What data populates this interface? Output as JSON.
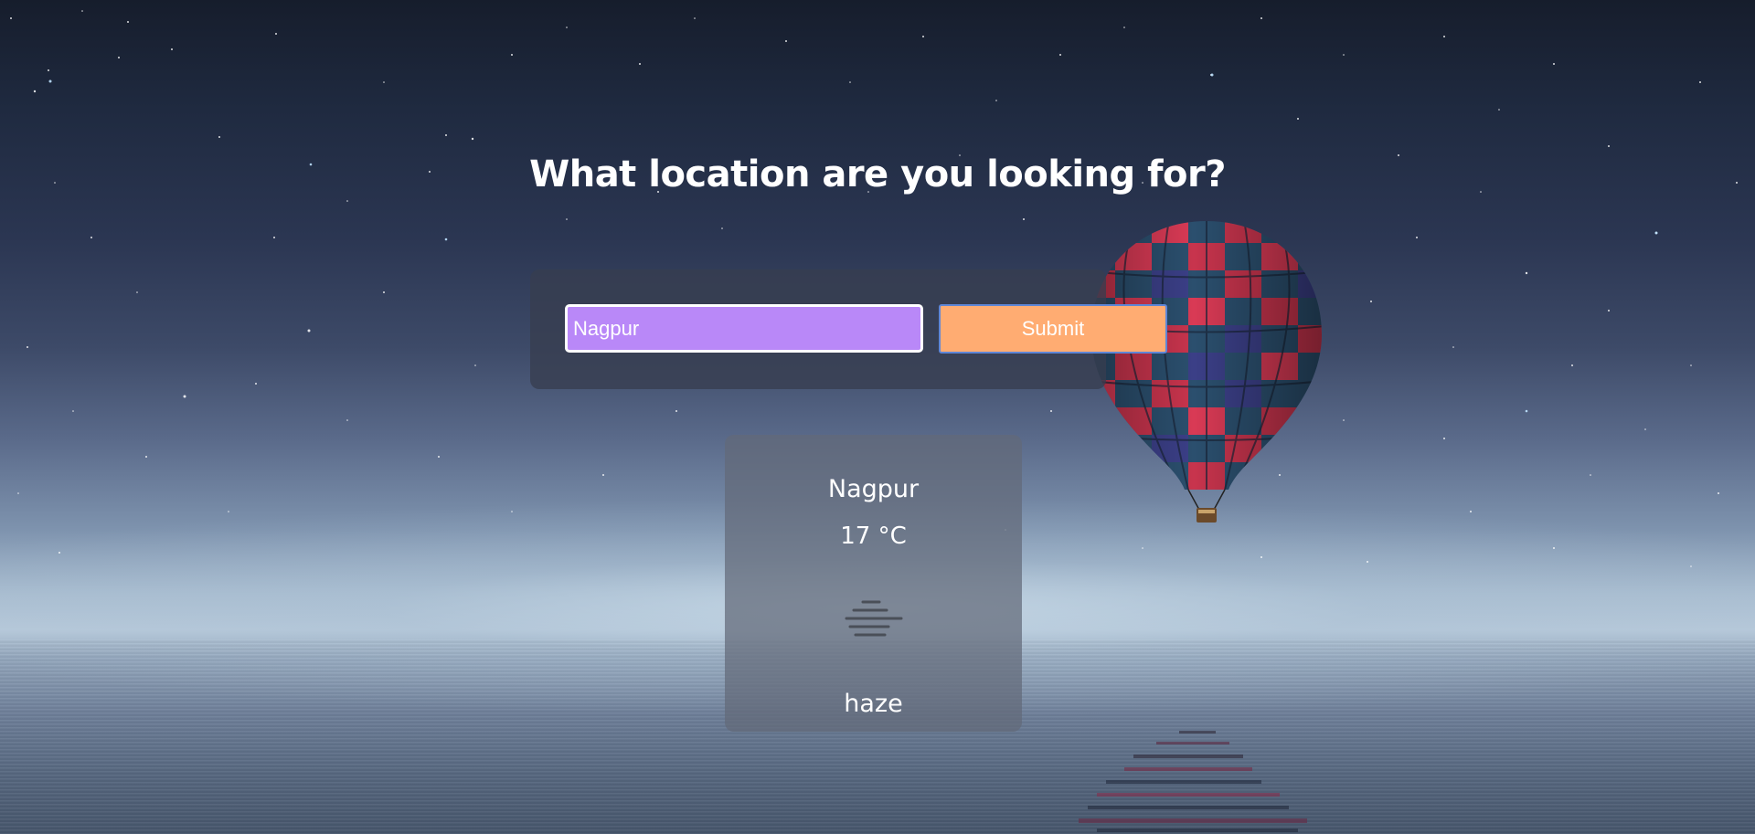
{
  "page": {
    "title": "What location are you looking for?"
  },
  "search": {
    "value": "Nagpur",
    "submit_label": "Submit"
  },
  "weather": {
    "city": "Nagpur",
    "temperature": "17 °C",
    "icon": "haze-icon",
    "condition": "haze"
  },
  "colors": {
    "input_bg": "#b988f8",
    "button_bg": "#ffac72",
    "panel_bg": "#373e50",
    "card_bg": "#626a78",
    "text": "#ffffff"
  }
}
